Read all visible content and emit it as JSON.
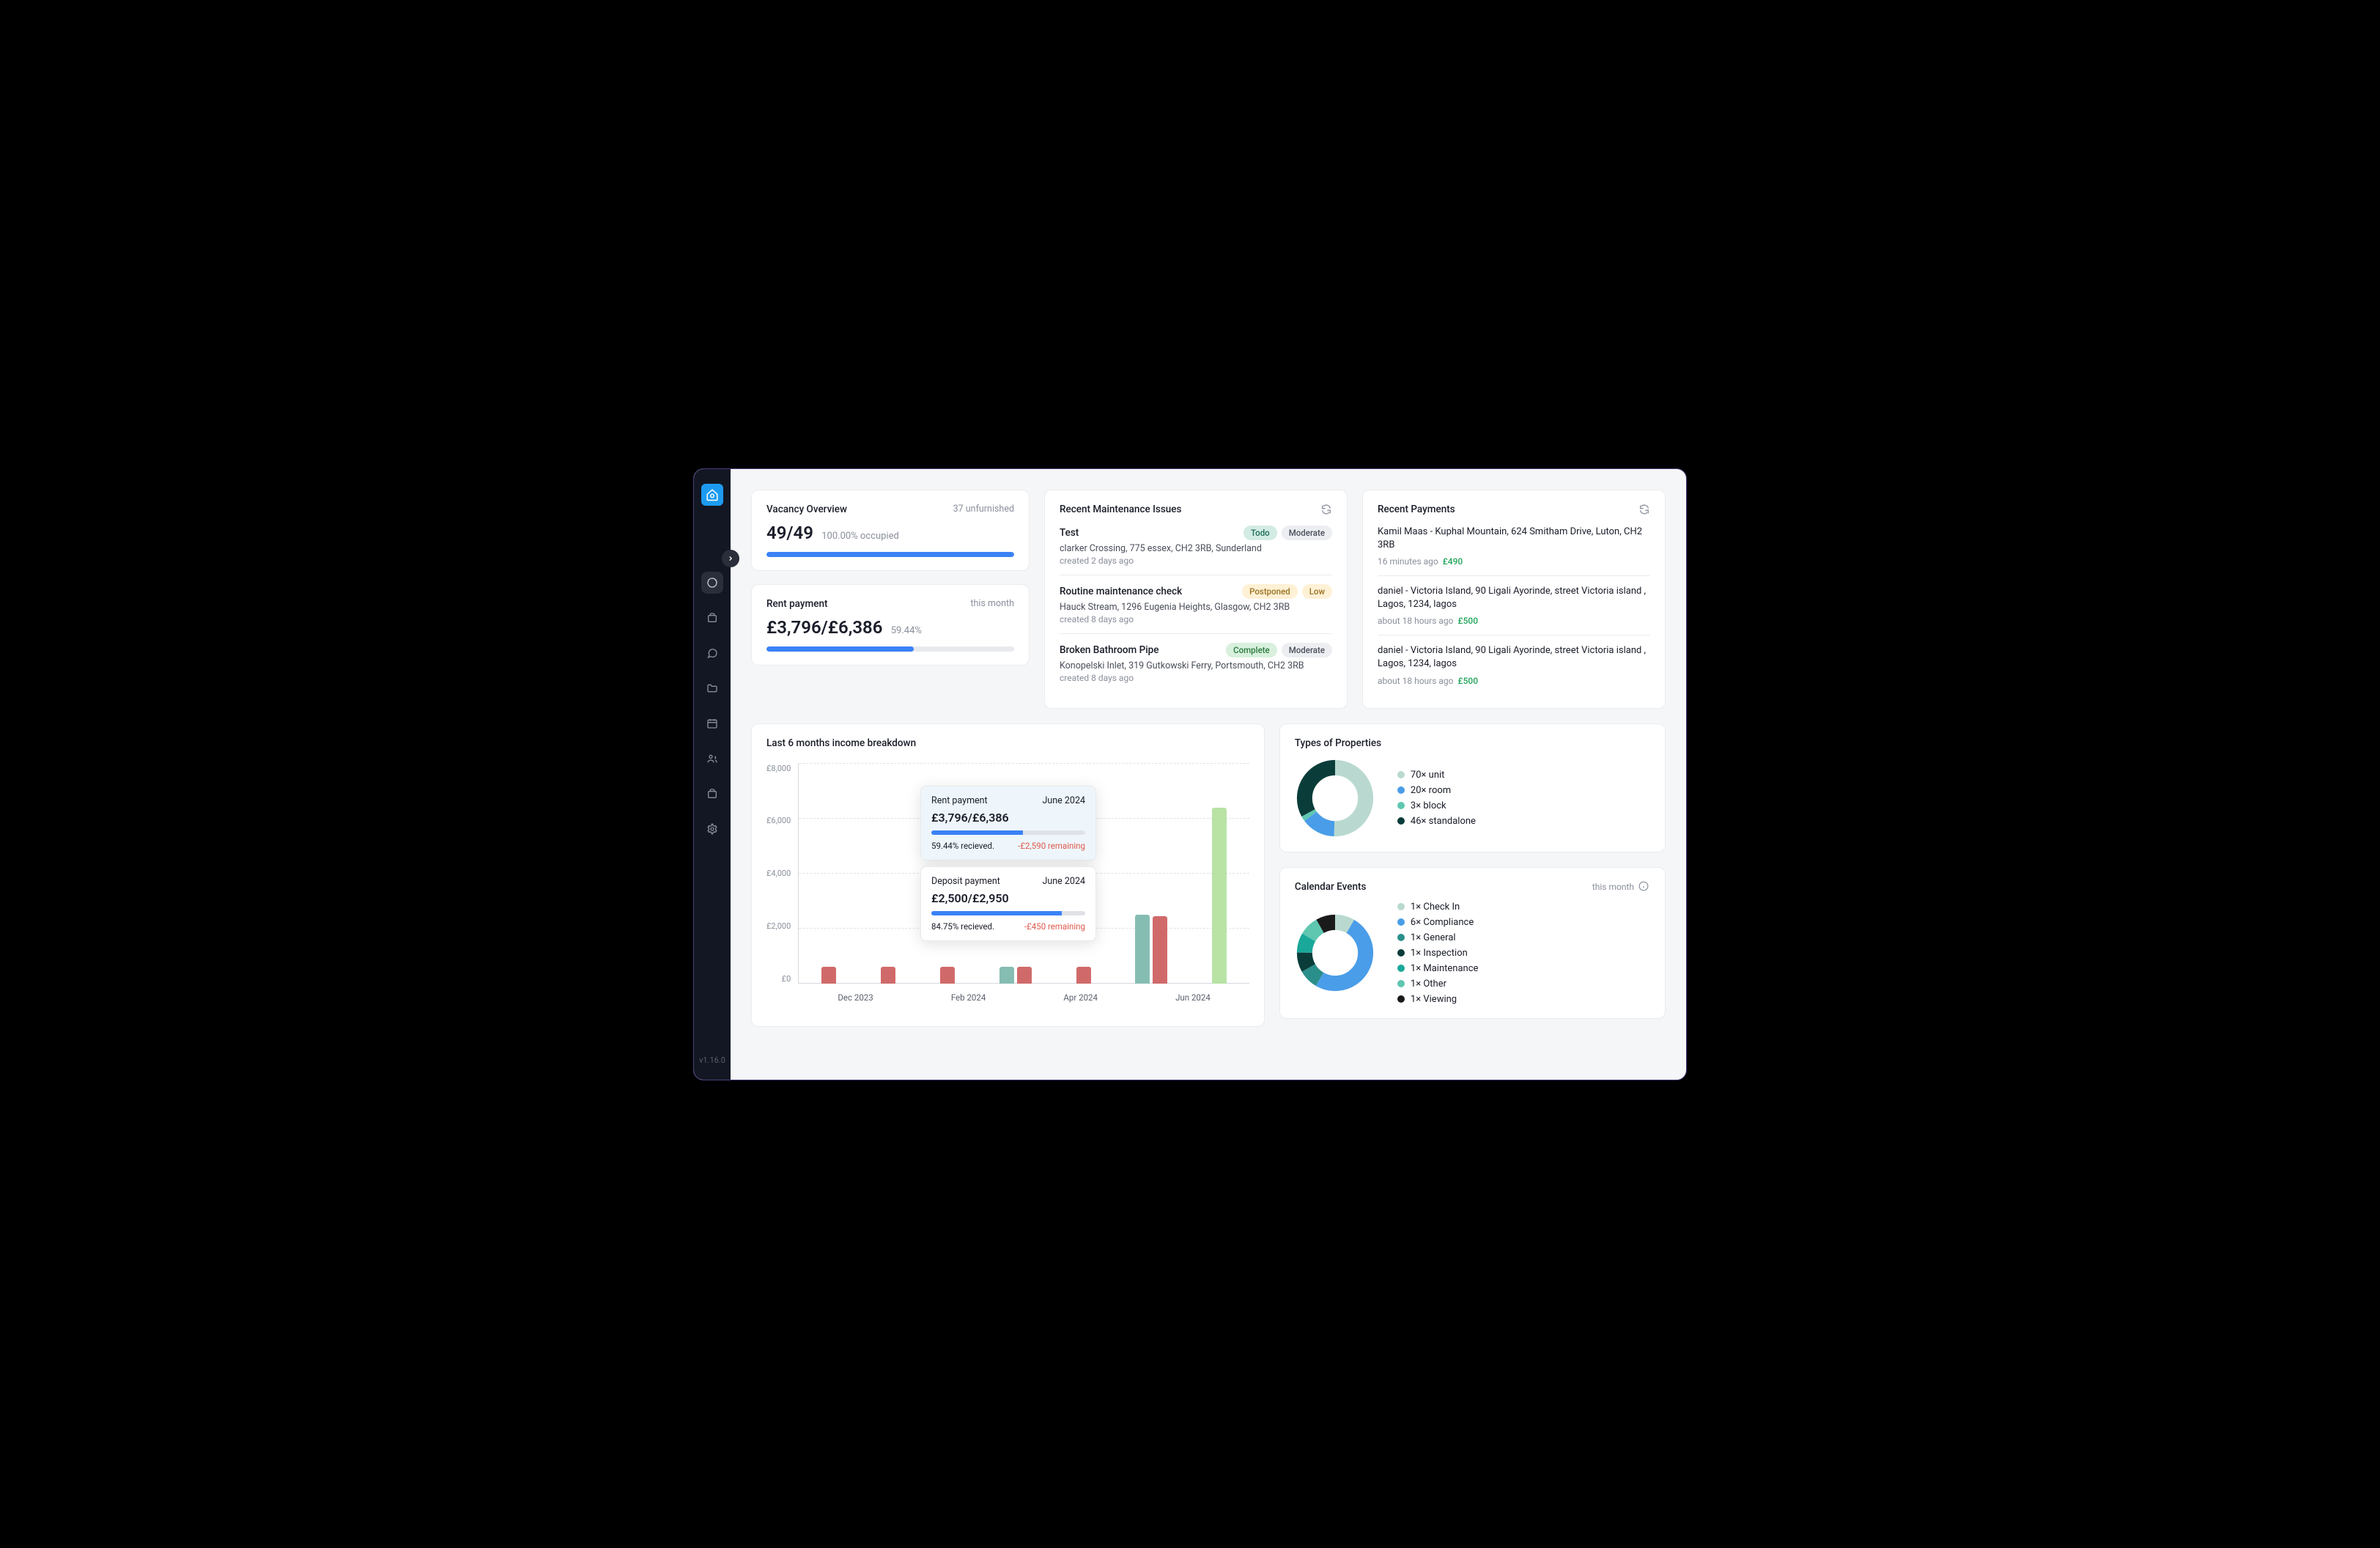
{
  "sidebar": {
    "version": "v1.16.0",
    "nav": [
      "dashboard",
      "properties",
      "messages",
      "files",
      "calendar",
      "contacts",
      "tasks",
      "settings"
    ]
  },
  "vacancy": {
    "title": "Vacancy Overview",
    "unfurnished": "37 unfurnished",
    "stat": "49/49",
    "occupied": "100.00% occupied",
    "pct": 100
  },
  "rent": {
    "title": "Rent payment",
    "period": "this month",
    "stat": "£3,796/£6,386",
    "pct_label": "59.44%",
    "pct": 59.44
  },
  "maintenance": {
    "title": "Recent Maintenance Issues",
    "items": [
      {
        "title": "Test",
        "status": "Todo",
        "status_class": "b-todo",
        "priority": "Moderate",
        "priority_class": "b-moderate",
        "loc": "clarker Crossing, 775 essex, CH2 3RB, Sunderland",
        "created": "created 2 days ago"
      },
      {
        "title": "Routine maintenance check",
        "status": "Postponed",
        "status_class": "b-postponed",
        "priority": "Low",
        "priority_class": "b-low",
        "loc": "Hauck Stream, 1296 Eugenia Heights, Glasgow, CH2 3RB",
        "created": "created 8 days ago"
      },
      {
        "title": "Broken Bathroom Pipe",
        "status": "Complete",
        "status_class": "b-complete",
        "priority": "Moderate",
        "priority_class": "b-moderate",
        "loc": "Konopelski Inlet, 319 Gutkowski Ferry, Portsmouth, CH2 3RB",
        "created": "created 8 days ago"
      }
    ]
  },
  "payments": {
    "title": "Recent Payments",
    "items": [
      {
        "desc": "Kamil Maas - Kuphal Mountain, 624 Smitham Drive, Luton, CH2 3RB",
        "time": "16 minutes ago",
        "amount": "£490"
      },
      {
        "desc": "daniel - Victoria Island, 90 Ligali Ayorinde, street Victoria island , Lagos, 1234, lagos",
        "time": "about 18 hours ago",
        "amount": "£500"
      },
      {
        "desc": "daniel - Victoria Island, 90 Ligali Ayorinde, street Victoria island , Lagos, 1234, lagos",
        "time": "about 18 hours ago",
        "amount": "£500"
      }
    ]
  },
  "chart": {
    "title": "Last 6 months income breakdown",
    "tooltips": [
      {
        "label": "Rent payment",
        "period": "June 2024",
        "amount": "£3,796/£6,386",
        "received": "59.44% recieved.",
        "remaining": "-£2,590 remaining",
        "pct": 59.44,
        "cls": "rent"
      },
      {
        "label": "Deposit payment",
        "period": "June 2024",
        "amount": "£2,500/£2,950",
        "received": "84.75% recieved.",
        "remaining": "-£450 remaining",
        "pct": 84.75,
        "cls": ""
      }
    ]
  },
  "chart_data": {
    "type": "bar",
    "title": "Last 6 months income breakdown",
    "ylabel": "£",
    "ylim": [
      0,
      8000
    ],
    "yticks": [
      0,
      2000,
      4000,
      6000,
      8000
    ],
    "categories": [
      "Dec 2023",
      "Jan 2024",
      "Feb 2024",
      "Mar 2024",
      "Apr 2024",
      "May 2024",
      "Jun 2024"
    ],
    "x_tick_labels": [
      "Dec 2023",
      "Feb 2024",
      "Apr 2024",
      "Jun 2024"
    ],
    "series": [
      {
        "name": "teal",
        "color": "#86bdb2",
        "values": [
          0,
          0,
          0,
          600,
          0,
          2500,
          0
        ]
      },
      {
        "name": "red",
        "color": "#d06a6a",
        "values": [
          600,
          600,
          600,
          600,
          600,
          2450,
          0
        ]
      },
      {
        "name": "lightgreen",
        "color": "#b8e3a5",
        "values": [
          0,
          0,
          0,
          0,
          0,
          0,
          6386
        ]
      }
    ]
  },
  "prop_types": {
    "title": "Types of Properties",
    "items": [
      {
        "count": "70×",
        "label": "unit",
        "color": "#b9d9d0"
      },
      {
        "count": "20×",
        "label": "room",
        "color": "#4a9de8"
      },
      {
        "count": "3×",
        "label": "block",
        "color": "#5fc6b0"
      },
      {
        "count": "46×",
        "label": "standalone",
        "color": "#0a3d3a"
      }
    ]
  },
  "calendar": {
    "title": "Calendar Events",
    "period": "this month",
    "items": [
      {
        "count": "1×",
        "label": "Check In",
        "color": "#b9d9d0"
      },
      {
        "count": "6×",
        "label": "Compliance",
        "color": "#4a9de8"
      },
      {
        "count": "1×",
        "label": "General",
        "color": "#2a8f8a"
      },
      {
        "count": "1×",
        "label": "Inspection",
        "color": "#0a3d3a"
      },
      {
        "count": "1×",
        "label": "Maintenance",
        "color": "#1aa89a"
      },
      {
        "count": "1×",
        "label": "Other",
        "color": "#5fc6b0"
      },
      {
        "count": "1×",
        "label": "Viewing",
        "color": "#1a1a1a"
      }
    ]
  }
}
